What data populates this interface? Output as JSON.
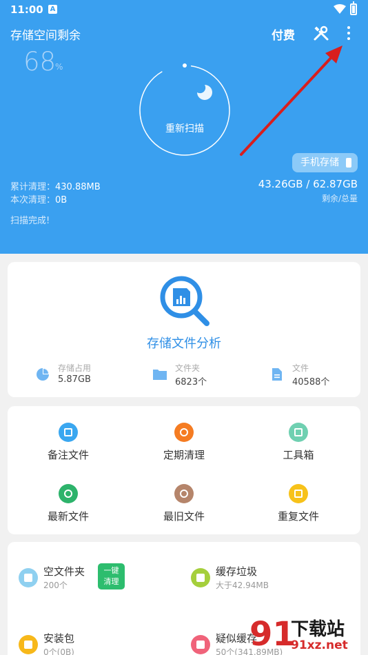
{
  "status": {
    "time": "11:00",
    "notif_letter": "A"
  },
  "header": {
    "title": "存储空间剩余",
    "pay_label": "付费",
    "tools_icon": "wrench-screwdriver-icon",
    "more_icon": "more-vert-icon",
    "percent": "68",
    "percent_unit": "%",
    "rescan_label": "重新扫描",
    "phone_storage_label": "手机存储",
    "total_cleaned_label": "累计清理：",
    "total_cleaned_value": "430.88MB",
    "this_cleaned_label": "本次清理：",
    "this_cleaned_value": "0B",
    "capacity": "43.26GB / 62.87GB",
    "capacity_sub": "剩余/总量",
    "scan_status": "扫描完成!"
  },
  "analysis": {
    "title": "存储文件分析",
    "stats": [
      {
        "label": "存储占用",
        "value": "5.87GB",
        "icon": "pie-chart-icon"
      },
      {
        "label": "文件夹",
        "value": "6823个",
        "icon": "folder-icon"
      },
      {
        "label": "文件",
        "value": "40588个",
        "icon": "document-icon"
      }
    ]
  },
  "tools": [
    {
      "label": "备注文件",
      "icon": "note-edit-icon",
      "color": "#3aa7f0"
    },
    {
      "label": "定期清理",
      "icon": "alarm-clock-icon",
      "color": "#f57c22"
    },
    {
      "label": "工具箱",
      "icon": "toolbox-grid-icon",
      "color": "#6fd0b1"
    },
    {
      "label": "最新文件",
      "icon": "newest-file-icon",
      "color": "#2db36b"
    },
    {
      "label": "最旧文件",
      "icon": "oldest-file-icon",
      "color": "#b5856b"
    },
    {
      "label": "重复文件",
      "icon": "duplicate-file-icon",
      "color": "#f7c21a"
    }
  ],
  "list": [
    {
      "title": "空文件夹",
      "sub": "200个",
      "icon": "folder-icon",
      "color": "#8fd0f0"
    },
    {
      "title": "缓存垃圾",
      "sub": "大于42.94MB",
      "icon": "trash-icon",
      "color": "#a5cf3c"
    },
    {
      "title": "安装包",
      "sub": "0个(0B)",
      "icon": "android-icon",
      "color": "#f7b81a"
    },
    {
      "title": "疑似缓存",
      "sub": "50个(341.89MB)",
      "icon": "suspect-cache-icon",
      "color": "#f0637a"
    }
  ],
  "onekey": {
    "line1": "一键",
    "line2": "清理"
  },
  "watermark": {
    "text": "下载站",
    "url": "91xz.net",
    "logo": "91"
  }
}
